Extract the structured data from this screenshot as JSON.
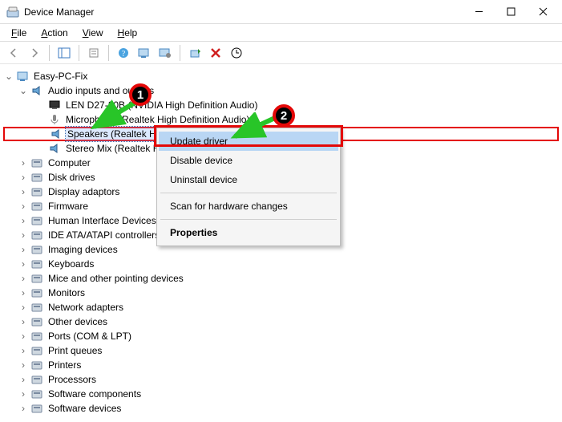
{
  "window": {
    "title": "Device Manager"
  },
  "menu": {
    "file": "File",
    "action": "Action",
    "view": "View",
    "help": "Help"
  },
  "toolbar_icons": {
    "back": "back-icon",
    "forward": "forward-icon",
    "up": "up-icon",
    "properties": "properties-icon",
    "help": "help-icon",
    "monitor1": "monitor-icon",
    "monitor2": "monitor-settings-icon",
    "refresh": "refresh-icon",
    "remove": "remove-icon",
    "scan": "scan-icon"
  },
  "tree": {
    "root": "Easy-PC-Fix",
    "audio_group": "Audio inputs and outputs",
    "audio_children": {
      "len": "LEN D27-20B (NVIDIA High Definition Audio)",
      "mic": "Microphone (Realtek High Definition Audio)",
      "spk": "Speakers (Realtek High Definition Audio)",
      "stereo": "Stereo Mix (Realtek High Definition Audio)"
    },
    "categories": [
      "Computer",
      "Disk drives",
      "Display adaptors",
      "Firmware",
      "Human Interface Devices",
      "IDE ATA/ATAPI controllers",
      "Imaging devices",
      "Keyboards",
      "Mice and other pointing devices",
      "Monitors",
      "Network adapters",
      "Other devices",
      "Ports (COM & LPT)",
      "Print queues",
      "Printers",
      "Processors",
      "Software components",
      "Software devices"
    ]
  },
  "context_menu": {
    "update": "Update driver",
    "disable": "Disable device",
    "uninstall": "Uninstall device",
    "scan": "Scan for hardware changes",
    "properties": "Properties"
  },
  "annotations": {
    "step1": "1",
    "step2": "2"
  }
}
